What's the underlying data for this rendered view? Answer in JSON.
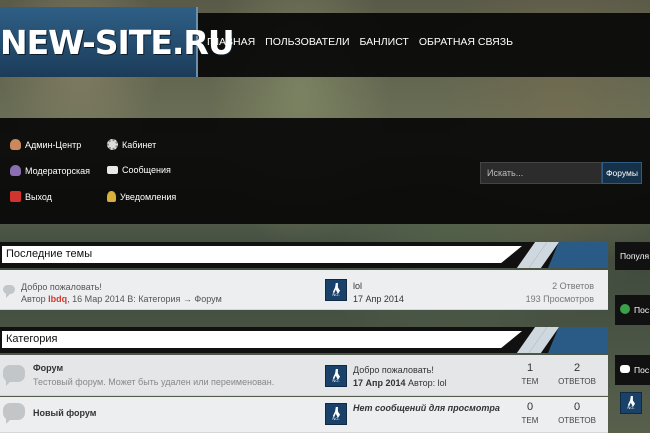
{
  "site": {
    "logo": "NEW-SITE.RU"
  },
  "nav": [
    "Главная",
    "Пользователи",
    "Банлист",
    "Обратная связь"
  ],
  "userpanel": {
    "admin": "Админ-Центр",
    "cabinet": "Кабинет",
    "moderator": "Модераторская",
    "messages": "Сообщения",
    "logout": "Выход",
    "notifications": "Уведомления"
  },
  "search": {
    "placeholder": "Искать...",
    "button": "Форумы"
  },
  "recent": {
    "title": "Последние темы",
    "topic": {
      "title": "Добро пожаловать!",
      "author_prefix": "Автор",
      "author": "lbdq",
      "date_in": ", 16 Мар 2014 В:",
      "category": "Категория",
      "arrow": "→",
      "forum": "Форум",
      "last_user": "lol",
      "last_date": "17 Апр 2014",
      "replies": "2 Ответов",
      "views": "193 Просмотров"
    }
  },
  "category": {
    "title": "Категория",
    "forums": [
      {
        "name": "Форум",
        "desc": "Тестовый форум. Может быть удален или переименован.",
        "last_title": "Добро пожаловать!",
        "last_date": "17 Апр 2014",
        "last_author_prefix": "Автор:",
        "last_author": "lol",
        "topics": "1",
        "topics_label": "ТЕМ",
        "replies": "2",
        "replies_label": "ОТВЕТОВ"
      },
      {
        "name": "Новый форум",
        "desc": "",
        "last_title": "Нет сообщений для просмотра",
        "topics": "0",
        "topics_label": "ТЕМ",
        "replies": "0",
        "replies_label": "ОТВЕТОВ"
      }
    ]
  },
  "sidebar": {
    "popular": "Популя",
    "post1": "Пос",
    "post2": "Пос"
  },
  "avatar_text": "NO-AVATAR",
  "colors": {
    "accent": "#2a5b86",
    "author_highlight": "#d43a2f",
    "bg_dark": "#0a0a0a"
  }
}
